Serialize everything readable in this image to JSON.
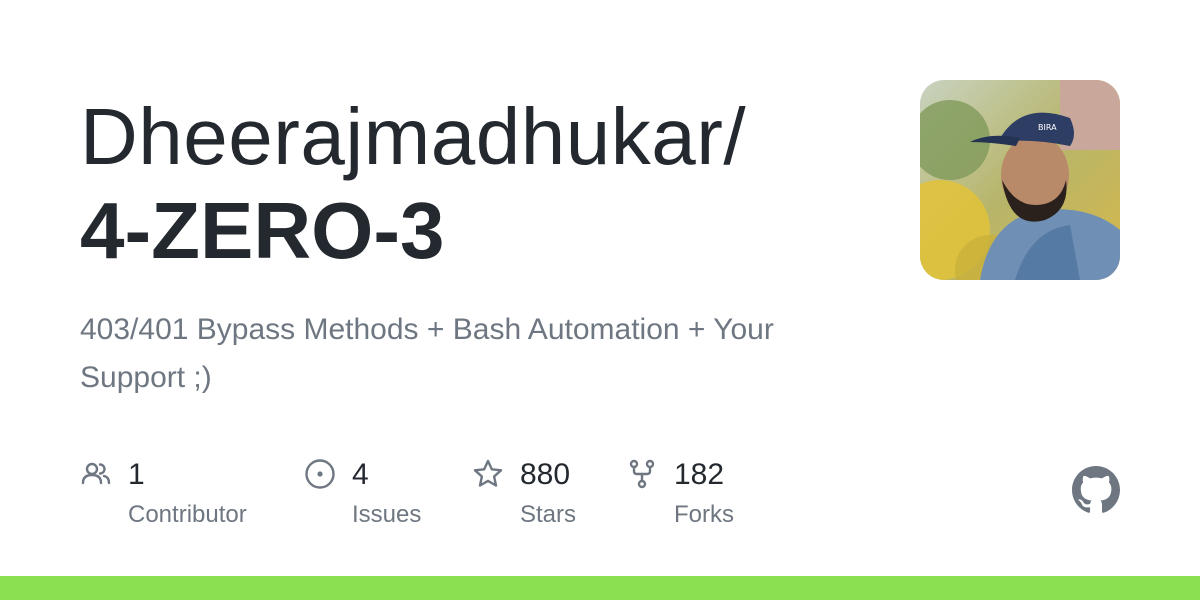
{
  "repo": {
    "owner": "Dheerajmadhukar/",
    "name": "4-ZERO-3",
    "description": "403/401 Bypass Methods + Bash Automation + Your Support ;)"
  },
  "stats": [
    {
      "icon": "people-icon",
      "value": "1",
      "label": "Contributor"
    },
    {
      "icon": "issue-icon",
      "value": "4",
      "label": "Issues"
    },
    {
      "icon": "star-icon",
      "value": "880",
      "label": "Stars"
    },
    {
      "icon": "fork-icon",
      "value": "182",
      "label": "Forks"
    }
  ],
  "colors": {
    "language_bar": "#89e051",
    "text_primary": "#24292f",
    "text_secondary": "#6e7781"
  }
}
